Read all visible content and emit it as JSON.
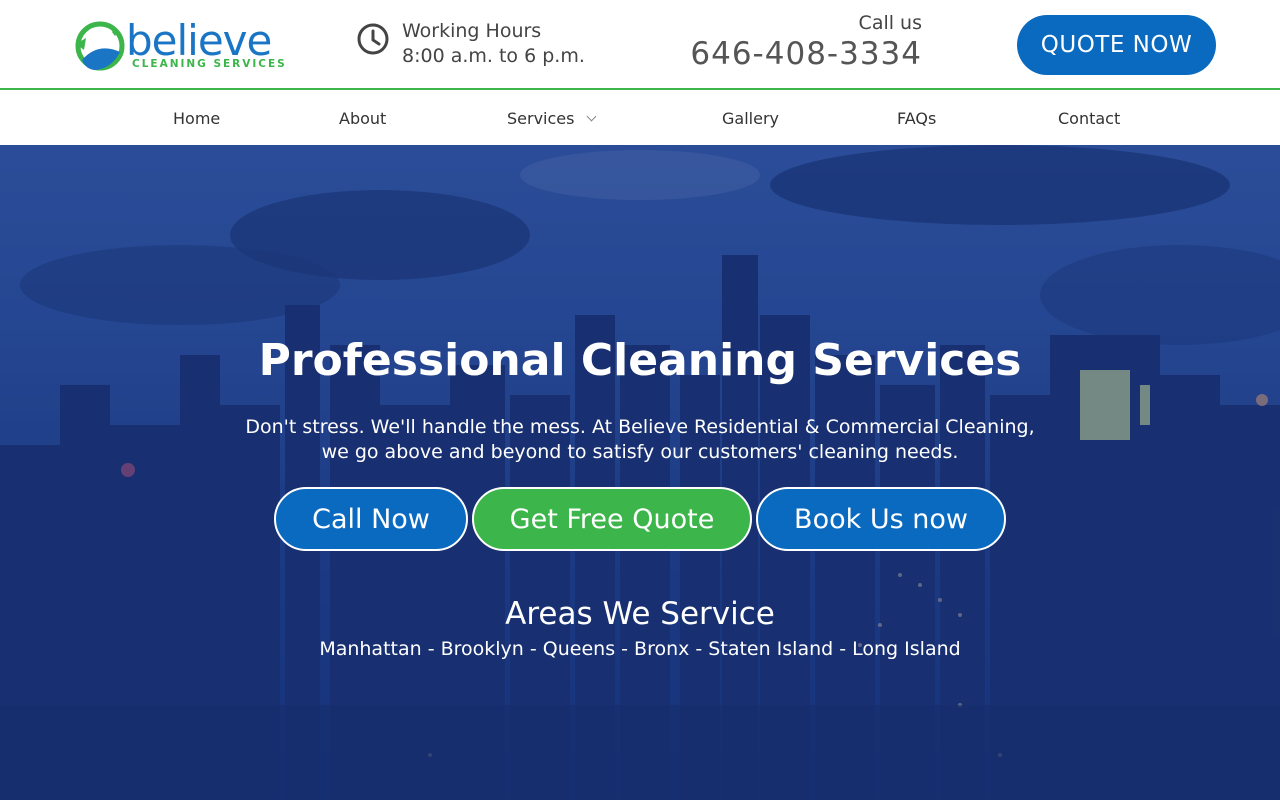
{
  "logo": {
    "word": "believe",
    "subtitle": "CLEANING SERVICES"
  },
  "header": {
    "hours_title": "Working Hours",
    "hours_time": "8:00 a.m. to 6 p.m.",
    "call_label": "Call us",
    "phone": "646-408-3334",
    "quote_button": "QUOTE NOW"
  },
  "nav": {
    "items": [
      "Home",
      "About",
      "Services",
      "Gallery",
      "FAQs",
      "Contact"
    ]
  },
  "hero": {
    "title": "Professional Cleaning Services",
    "subtitle_line1": "Don't stress. We'll handle the mess. At Believe Residential & Commercial Cleaning,",
    "subtitle_line2": "we go above and beyond to satisfy our customers' cleaning needs.",
    "buttons": {
      "call": "Call Now",
      "quote": "Get Free Quote",
      "book": "Book Us now"
    },
    "areas_title": "Areas We Service",
    "areas_list": "Manhattan - Brooklyn - Queens - Bronx - Staten Island - Long Island"
  },
  "colors": {
    "brand_blue": "#0a6ac0",
    "brand_green": "#3cb54a"
  },
  "icons": {
    "hours": "clock-icon",
    "services_dropdown": "chevron-down-icon"
  }
}
